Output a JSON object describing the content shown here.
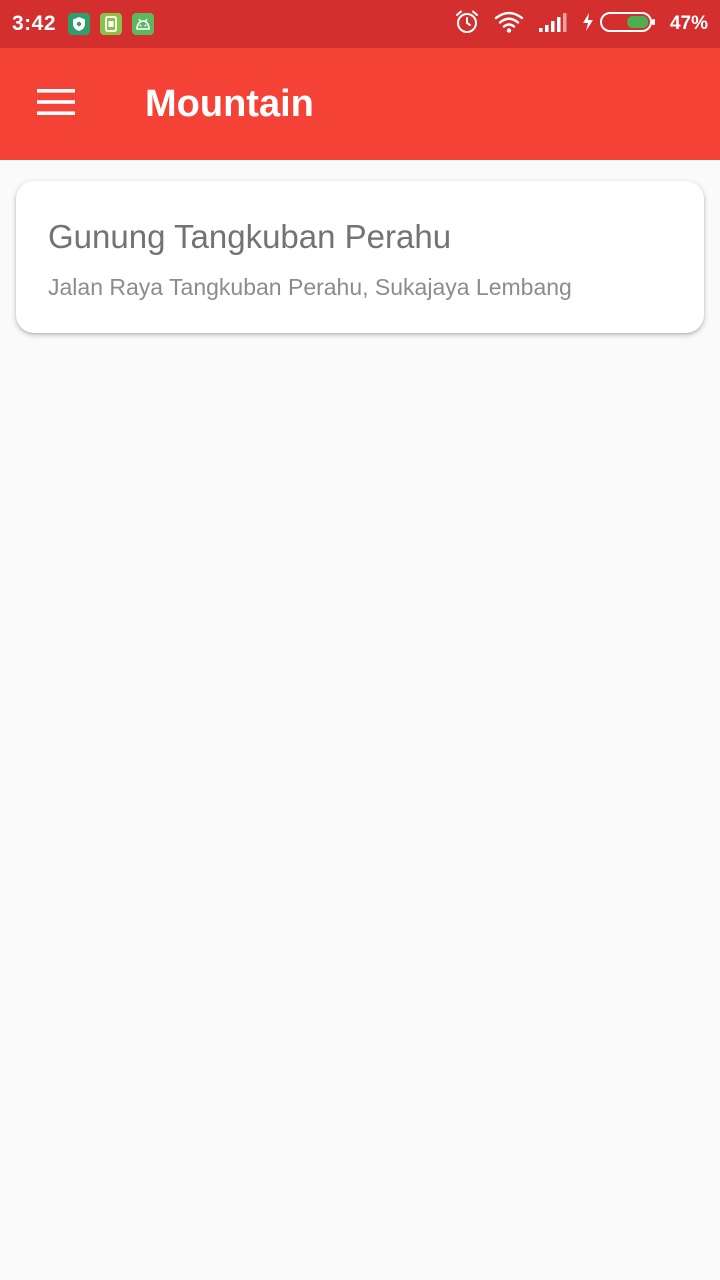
{
  "status_bar": {
    "time": "3:42",
    "battery_percent": "47%",
    "battery_level": 0.47,
    "notification_icons": [
      "shield-icon",
      "sim-card-icon",
      "android-icon"
    ],
    "system_icons": [
      "alarm-icon",
      "wifi-icon",
      "signal-icon",
      "charging-icon",
      "battery-icon"
    ]
  },
  "app_bar": {
    "title": "Mountain",
    "menu_icon": "hamburger-menu-icon"
  },
  "list": {
    "items": [
      {
        "title": "Gunung Tangkuban Perahu",
        "subtitle": "Jalan Raya Tangkuban Perahu, Sukajaya Lembang"
      }
    ]
  },
  "colors": {
    "status_bar": "#d32f2f",
    "app_bar": "#f44336",
    "background": "#fafafa",
    "card": "#ffffff",
    "title_text": "#737373",
    "subtitle_text": "#8c8c8c",
    "battery_fill": "#4caf50"
  }
}
